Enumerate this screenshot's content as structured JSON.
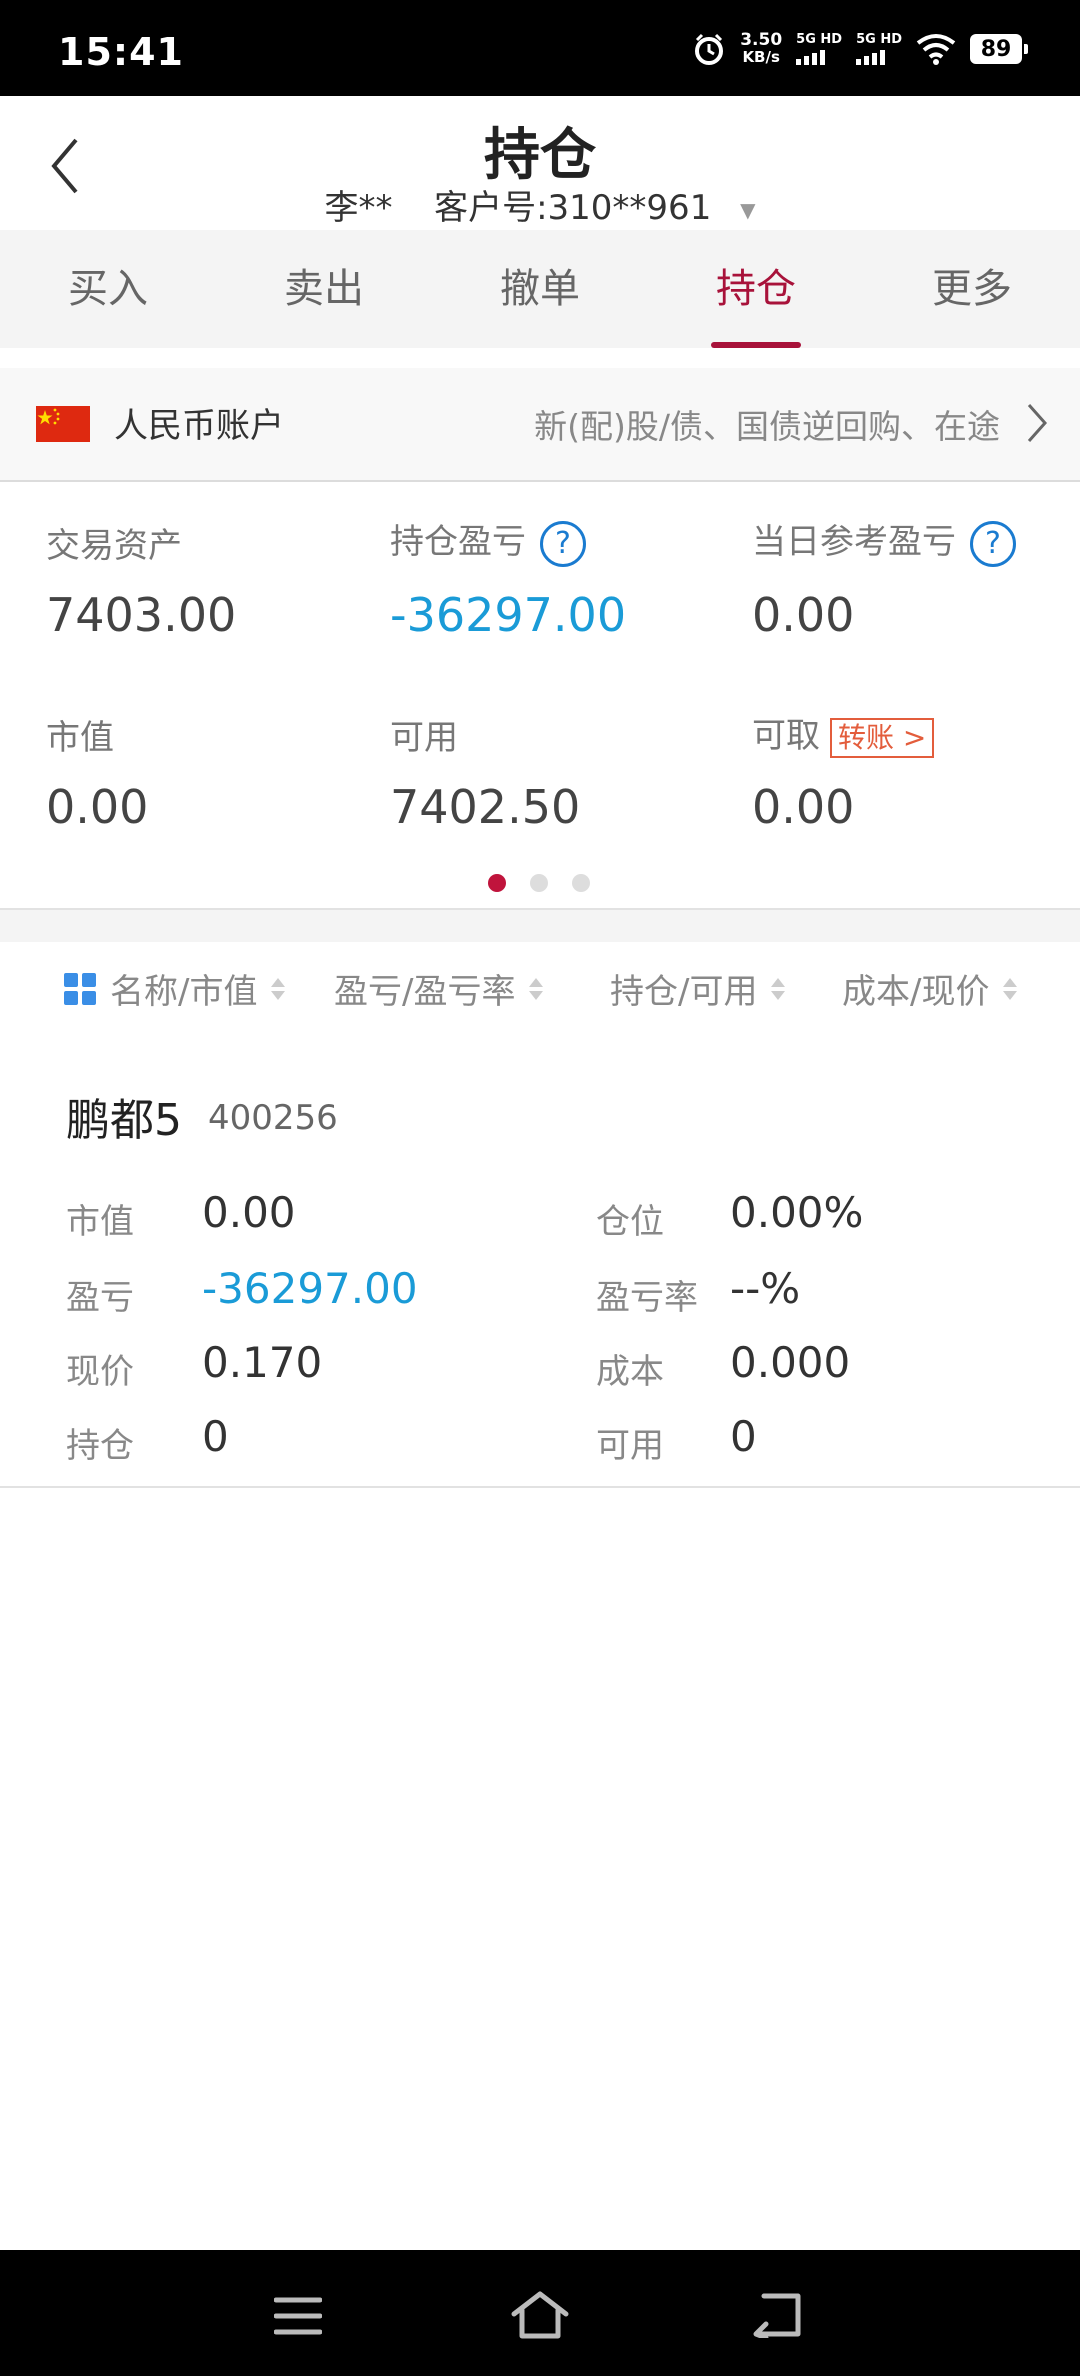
{
  "status_bar": {
    "time": "15:41",
    "net_speed": "3.50",
    "net_unit": "KB/s",
    "sim1": "5G HD",
    "sim2": "5G HD",
    "battery": "89"
  },
  "header": {
    "title": "持仓",
    "account_name": "李**",
    "customer_label": "客户号:310**961"
  },
  "tabs": [
    {
      "label": "买入",
      "active": false
    },
    {
      "label": "卖出",
      "active": false
    },
    {
      "label": "撤单",
      "active": false
    },
    {
      "label": "持仓",
      "active": true
    },
    {
      "label": "更多",
      "active": false
    }
  ],
  "account": {
    "name": "人民币账户",
    "note": "新(配)股/债、国债逆回购、在途"
  },
  "assets": {
    "trade_assets_label": "交易资产",
    "trade_assets": "7403.00",
    "position_pl_label": "持仓盈亏",
    "position_pl": "-36297.00",
    "daily_pl_label": "当日参考盈亏",
    "daily_pl": "0.00",
    "market_value_label": "市值",
    "market_value": "0.00",
    "available_label": "可用",
    "available": "7402.50",
    "withdrawable_label": "可取",
    "withdrawable": "0.00",
    "transfer_label": "转账 >"
  },
  "columns": [
    "名称/市值",
    "盈亏/盈亏率",
    "持仓/可用",
    "成本/现价"
  ],
  "holdings": [
    {
      "name": "鹏都5",
      "code": "400256",
      "market_value_label": "市值",
      "market_value": "0.00",
      "position_pct_label": "仓位",
      "position_pct": "0.00%",
      "pl_label": "盈亏",
      "pl": "-36297.00",
      "pl_rate_label": "盈亏率",
      "pl_rate": "--%",
      "price_label": "现价",
      "price": "0.170",
      "cost_label": "成本",
      "cost": "0.000",
      "qty_label": "持仓",
      "qty": "0",
      "avail_label": "可用",
      "avail": "0"
    }
  ],
  "colors": {
    "accent": "#a8123a",
    "loss_blue": "#1a9bd7"
  }
}
